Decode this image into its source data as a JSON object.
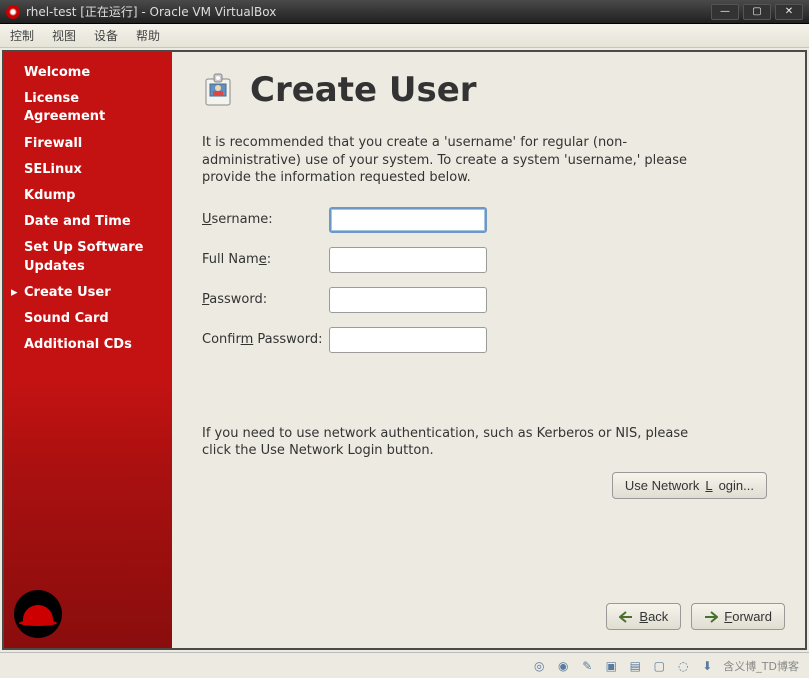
{
  "window": {
    "title": "rhel-test [正在运行] - Oracle VM VirtualBox"
  },
  "menubar": {
    "items": [
      "控制",
      "视图",
      "设备",
      "帮助"
    ]
  },
  "sidebar": {
    "items": [
      {
        "label": "Welcome"
      },
      {
        "label": "License Agreement"
      },
      {
        "label": "Firewall"
      },
      {
        "label": "SELinux"
      },
      {
        "label": "Kdump"
      },
      {
        "label": "Date and Time"
      },
      {
        "label": "Set Up Software Updates"
      },
      {
        "label": "Create User",
        "active": true
      },
      {
        "label": "Sound Card"
      },
      {
        "label": "Additional CDs"
      }
    ]
  },
  "page": {
    "title": "Create User",
    "intro": "It is recommended that you create a 'username' for regular (non-administrative) use of your system. To create a system 'username,' please provide the information requested below.",
    "labels": {
      "username": "Username:",
      "fullname": "Full Name:",
      "password": "Password:",
      "confirm": "Confirm Password:"
    },
    "fields": {
      "username": "",
      "fullname": "",
      "password": "",
      "confirm": ""
    },
    "network_text": "If you need to use network authentication, such as Kerberos or NIS, please click the Use Network Login button.",
    "network_button": "Use Network Login...",
    "back_button": "Back",
    "forward_button": "Forward"
  },
  "statusbar": {
    "watermark": "含义博_TD博客"
  }
}
